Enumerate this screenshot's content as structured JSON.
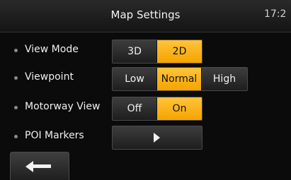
{
  "header": {
    "title": "Map Settings",
    "clock": "17:2"
  },
  "settings": {
    "view_mode": {
      "label": "View Mode",
      "options": [
        "3D",
        "2D"
      ],
      "selected": "2D"
    },
    "viewpoint": {
      "label": "Viewpoint",
      "options": [
        "Low",
        "Normal",
        "High"
      ],
      "selected": "Normal"
    },
    "motorway_view": {
      "label": "Motorway View",
      "options": [
        "Off",
        "On"
      ],
      "selected": "On"
    },
    "poi_markers": {
      "label": "POI Markers",
      "button_icon": "play-right-icon"
    }
  },
  "footer": {
    "back_icon": "back-arrow-icon"
  },
  "colors": {
    "accent": "#f5a400",
    "background": "#0b0b0b",
    "button": "#2e2e2e"
  }
}
